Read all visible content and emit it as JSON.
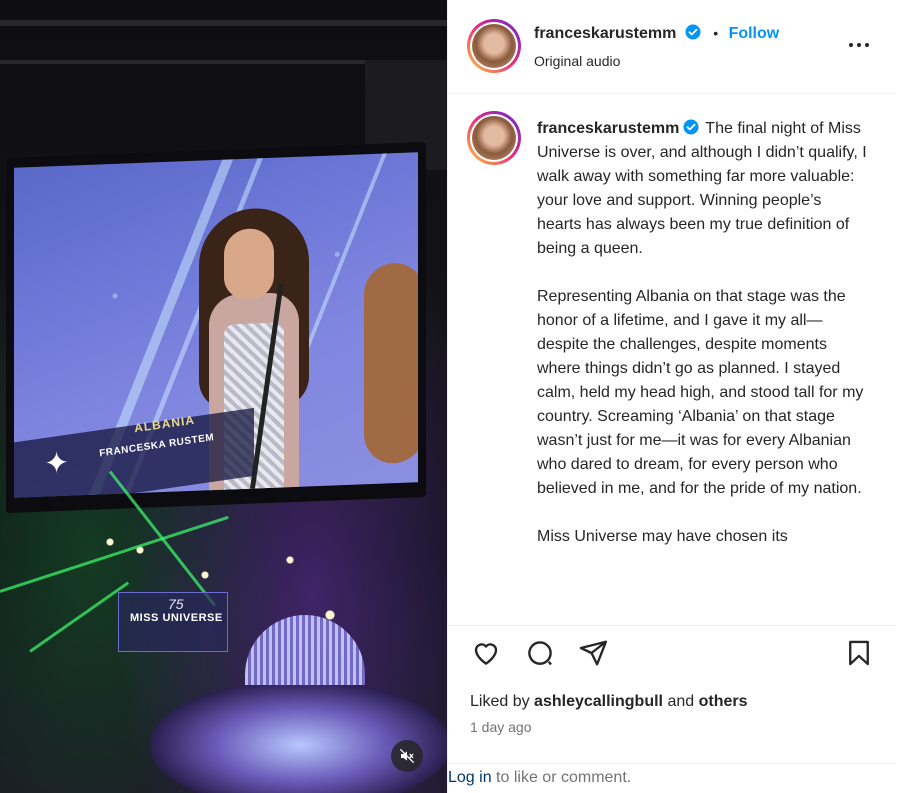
{
  "media": {
    "screen_country": "ALBANIA",
    "screen_name": "FRANCESKA RUSTEM",
    "stage_number": "75",
    "stage_brand": "MISS UNIVERSE",
    "mute_icon": "speaker-muted-icon"
  },
  "header": {
    "username": "franceskarustemm",
    "follow_label": "Follow",
    "separator": "•",
    "audio_label": "Original audio"
  },
  "caption": {
    "username": "franceskarustemm",
    "paragraphs": [
      "The final night of Miss Universe is over, and although I didn’t qualify, I walk away with something far more valuable: your love and support. Winning people’s hearts has always been my true definition of being a queen.",
      "Representing Albania on that stage was the honor of a lifetime, and I gave it my all—despite the challenges, despite moments where things didn’t go as planned. I stayed calm, held my head high, and stood tall for my country. Screaming ‘Albania’ on that stage wasn’t just for me—it was for every Albanian who dared to dream, for every person who believed in me, and for the pride of my nation.",
      "Miss Universe may have chosen its"
    ]
  },
  "actions": {
    "icons": [
      "heart-icon",
      "comment-icon",
      "share-icon",
      "bookmark-icon"
    ],
    "liked_prefix": "Liked by",
    "liked_user": "ashleycallingbull",
    "liked_and": "and",
    "liked_others": "others",
    "time": "1 day ago",
    "login_link": "Log in",
    "login_rest": "to like or comment."
  },
  "colors": {
    "accent": "#0095f6",
    "verified": "#0095f6",
    "text": "#262626",
    "muted": "#737373"
  }
}
